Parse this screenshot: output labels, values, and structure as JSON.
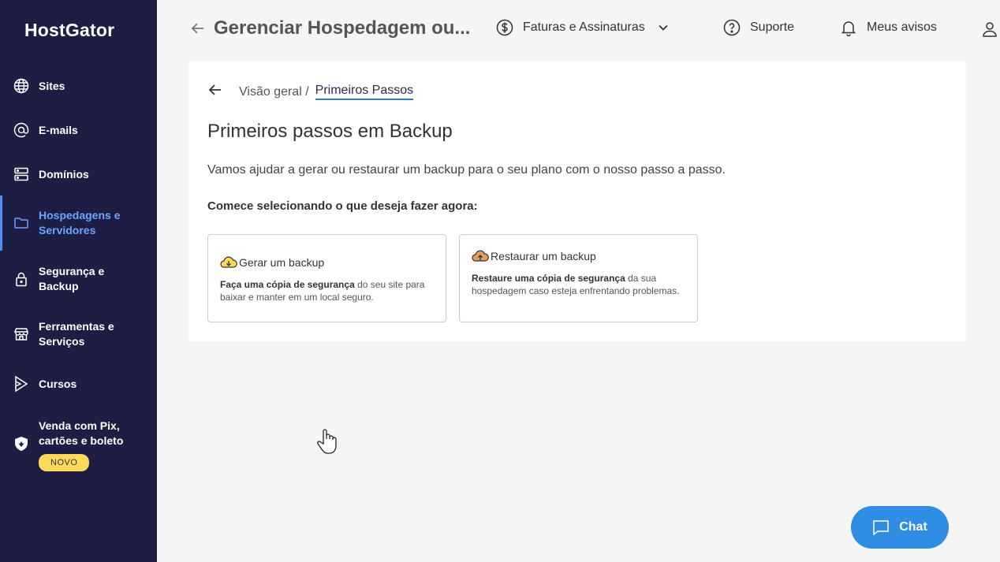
{
  "brand": "HostGator",
  "sidebar": {
    "items": [
      {
        "label": "Sites",
        "icon": "globe-icon"
      },
      {
        "label": "E-mails",
        "icon": "at-icon"
      },
      {
        "label": "Domínios",
        "icon": "server-icon"
      },
      {
        "label": "Hospedagens e Servidores",
        "icon": "folder-icon",
        "active": true
      },
      {
        "label": "Segurança e Backup",
        "icon": "lock-icon"
      },
      {
        "label": "Ferramentas e Serviços",
        "icon": "store-icon"
      },
      {
        "label": "Cursos",
        "icon": "play-icon"
      },
      {
        "label": "Venda com Pix, cartões e boleto",
        "icon": "shield-icon",
        "badge": "NOVO"
      }
    ]
  },
  "header": {
    "title": "Gerenciar Hospedagem ou...",
    "billing": "Faturas e Assinaturas",
    "support": "Suporte",
    "notices": "Meus avisos"
  },
  "breadcrumb": {
    "parent": "Visão geral /",
    "current": "Primeiros Passos"
  },
  "main": {
    "title": "Primeiros passos em Backup",
    "description": "Vamos ajudar a gerar ou restaurar um backup para o seu plano com o nosso passo a passo.",
    "prompt": "Comece selecionando o que deseja fazer agora:",
    "options": [
      {
        "title": "Gerar um backup",
        "desc_bold": "Faça uma cópia de segurança",
        "desc_rest": " do seu site para baixar e manter em um local seguro."
      },
      {
        "title": "Restaurar um backup",
        "desc_bold": "Restaure uma cópia de segurança",
        "desc_rest": " da sua hospedagem caso esteja enfrentando problemas."
      }
    ]
  },
  "chat": {
    "label": "Chat"
  },
  "colors": {
    "sidebar": "#1e1e45",
    "accent": "#2f8de4",
    "badge": "#ffd95a"
  }
}
